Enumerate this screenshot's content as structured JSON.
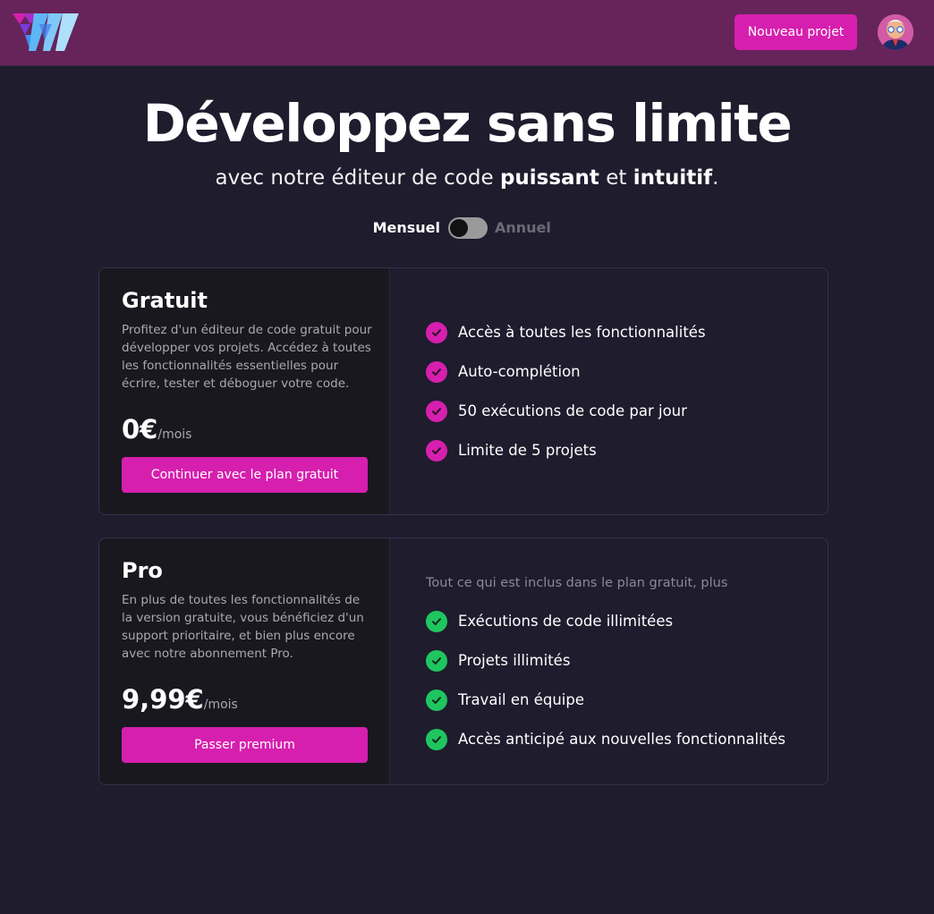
{
  "header": {
    "new_project_label": "Nouveau projet",
    "brand_color": "#d61fae",
    "header_bg": "#66245a"
  },
  "hero": {
    "title": "Développez sans limite",
    "subtitle_prefix": "avec notre éditeur de code ",
    "subtitle_bold_1": "puissant",
    "subtitle_middle": " et ",
    "subtitle_bold_2": "intuitif",
    "subtitle_suffix": "."
  },
  "billing": {
    "monthly_label": "Mensuel",
    "yearly_label": "Annuel",
    "selected": "Mensuel"
  },
  "plans": [
    {
      "name": "Gratuit",
      "description": "Profitez d'un éditeur de code gratuit pour développer vos projets. Accédez à toutes les fonctionnalités essentielles pour écrire, tester et déboguer votre code.",
      "price": "0€",
      "period": "/mois",
      "cta": "Continuer avec le plan gratuit",
      "includes_note": "",
      "check_color": "#d61fae",
      "features": [
        "Accès à toutes les fonctionnalités",
        "Auto-complétion",
        "50 exécutions de code par jour",
        "Limite de 5 projets"
      ]
    },
    {
      "name": "Pro",
      "description": "En plus de toutes les fonctionnalités de la version gratuite, vous bénéficiez d'un support prioritaire, et bien plus encore avec notre abonnement Pro.",
      "price": "9,99€",
      "period": "/mois",
      "cta": "Passer premium",
      "includes_note": "Tout ce qui est inclus dans le plan gratuit, plus",
      "check_color": "#1fc65f",
      "features": [
        "Exécutions de code illimitées",
        "Projets illimités",
        "Travail en équipe",
        "Accès anticipé aux nouvelles fonctionnalités"
      ]
    }
  ]
}
